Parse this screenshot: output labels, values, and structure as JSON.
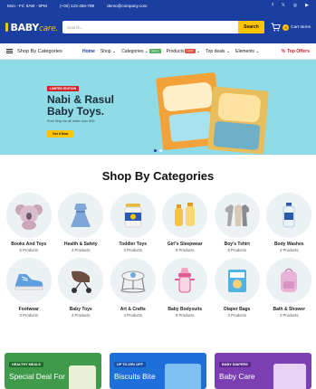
{
  "topbar": {
    "hours": "Mon - Fri: 8AM - 5PM",
    "phone": "(+00) 123-456-789",
    "email": "demo@company.com",
    "social": [
      "f",
      "x",
      "ig",
      "yt"
    ]
  },
  "header": {
    "logo_main": "BABY",
    "logo_sub": "care.",
    "search_placeholder": "Search...",
    "search_button": "Search",
    "cart_count": "0",
    "cart_label": "Cart items"
  },
  "nav": {
    "categories_label": "Shop By Categories",
    "links": [
      {
        "label": "Home",
        "active": true
      },
      {
        "label": "Shop",
        "caret": true
      },
      {
        "label": "Categories",
        "caret": true,
        "pill": "SALE"
      },
      {
        "label": "Products",
        "caret": true,
        "pill": "HOT"
      },
      {
        "label": "Top deals",
        "caret": true
      },
      {
        "label": "Elements",
        "caret": true
      }
    ],
    "offers_label": "Top Offers"
  },
  "hero": {
    "tag": "LIMITED EDITION",
    "title_line1": "Nabi & Rasul",
    "title_line2": "Baby Toys.",
    "subtitle": "Free Ship for all order over $35",
    "button": "Get it Now"
  },
  "categories": {
    "title": "Shop By Categories",
    "items": [
      {
        "name": "Books And Toys",
        "count": "6 Products",
        "icon": "koala-toy-icon"
      },
      {
        "name": "Health & Safety",
        "count": "4 Products",
        "icon": "dress-icon"
      },
      {
        "name": "Toddler Toys",
        "count": "3 Products",
        "icon": "formula-can-icon"
      },
      {
        "name": "Girl's Sleepwear",
        "count": "8 Products",
        "icon": "bottles-icon"
      },
      {
        "name": "Boy's Tshirt",
        "count": "5 Products",
        "icon": "bodysuit-icon"
      },
      {
        "name": "Body Washes",
        "count": "4 Products",
        "icon": "lotion-icon"
      },
      {
        "name": "Footwear",
        "count": "3 Products",
        "icon": "shoe-icon"
      },
      {
        "name": "Baby Toys",
        "count": "4 Products",
        "icon": "stroller-icon"
      },
      {
        "name": "Art & Crafts",
        "count": "4 Products",
        "icon": "walker-icon"
      },
      {
        "name": "Baby Bodysuits",
        "count": "8 Products",
        "icon": "sippy-cup-icon"
      },
      {
        "name": "Diaper Bags",
        "count": "3 Products",
        "icon": "diapers-icon"
      },
      {
        "name": "Bath & Shower",
        "count": "3 Products",
        "icon": "backpack-icon"
      }
    ]
  },
  "promos": [
    {
      "label": "HEALTHY MEALS",
      "title": "Special Deal For",
      "color": "#3f9a4a",
      "label_color": "#1f6b2c"
    },
    {
      "label": "UP TO 25% OFF",
      "title": "Biscuits Bite",
      "color": "#1e6fd9",
      "label_color": "#1850a8"
    },
    {
      "label": "BABY DIAPERS",
      "title": "Baby Care",
      "color": "#7b3fb1",
      "label_color": "#5a2a8a"
    }
  ],
  "colors": {
    "brand": "#1a3fa0",
    "accent": "#ffc400",
    "hero_bg": "#8fdce7",
    "offer_red": "#d2232a"
  }
}
